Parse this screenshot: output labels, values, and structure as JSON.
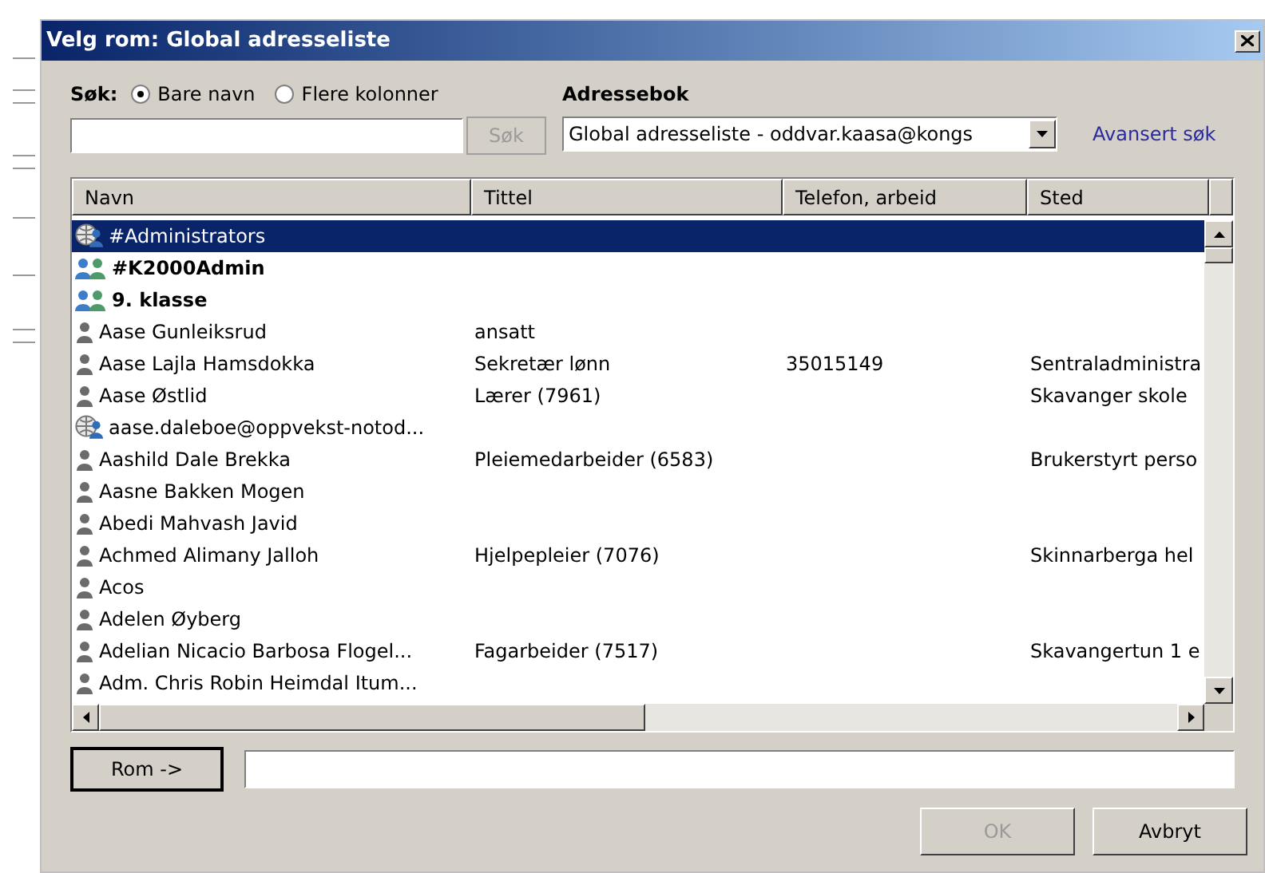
{
  "window": {
    "title": "Velg rom: Global adresseliste"
  },
  "search": {
    "label": "Søk:",
    "options": [
      {
        "label": "Bare navn",
        "selected": true
      },
      {
        "label": "Flere kolonner",
        "selected": false
      }
    ],
    "button": "Søk",
    "button_disabled": true
  },
  "address_book": {
    "label": "Adressebok",
    "value": "Global adresseliste - oddvar.kaasa@kongs",
    "advanced_link": "Avansert søk"
  },
  "table": {
    "columns": [
      "Navn",
      "Tittel",
      "Telefon, arbeid",
      "Sted"
    ],
    "rows": [
      {
        "kind": "external",
        "bold": false,
        "selected": true,
        "cells": [
          "#Administrators",
          "",
          "",
          ""
        ]
      },
      {
        "kind": "group",
        "bold": true,
        "selected": false,
        "cells": [
          "#K2000Admin",
          "",
          "",
          ""
        ]
      },
      {
        "kind": "group",
        "bold": true,
        "selected": false,
        "cells": [
          "9. klasse",
          "",
          "",
          ""
        ]
      },
      {
        "kind": "person",
        "bold": false,
        "selected": false,
        "cells": [
          "Aase Gunleiksrud",
          "ansatt",
          "",
          ""
        ]
      },
      {
        "kind": "person",
        "bold": false,
        "selected": false,
        "cells": [
          "Aase Lajla Hamsdokka",
          "Sekretær lønn",
          "35015149",
          "Sentraladministra"
        ]
      },
      {
        "kind": "person",
        "bold": false,
        "selected": false,
        "cells": [
          "Aase Østlid",
          "Lærer (7961)",
          "",
          "Skavanger skole"
        ]
      },
      {
        "kind": "external",
        "bold": false,
        "selected": false,
        "cells": [
          "aase.daleboe@oppvekst-notod...",
          "",
          "",
          ""
        ]
      },
      {
        "kind": "person",
        "bold": false,
        "selected": false,
        "cells": [
          "Aashild Dale Brekka",
          "Pleiemedarbeider (6583)",
          "",
          "Brukerstyrt perso"
        ]
      },
      {
        "kind": "person",
        "bold": false,
        "selected": false,
        "cells": [
          "Aasne Bakken Mogen",
          "",
          "",
          ""
        ]
      },
      {
        "kind": "person",
        "bold": false,
        "selected": false,
        "cells": [
          "Abedi Mahvash Javid",
          "",
          "",
          ""
        ]
      },
      {
        "kind": "person",
        "bold": false,
        "selected": false,
        "cells": [
          "Achmed Alimany Jalloh",
          "Hjelpepleier (7076)",
          "",
          "Skinnarberga hel"
        ]
      },
      {
        "kind": "person",
        "bold": false,
        "selected": false,
        "cells": [
          "Acos",
          "",
          "",
          ""
        ]
      },
      {
        "kind": "person",
        "bold": false,
        "selected": false,
        "cells": [
          "Adelen Øyberg",
          "",
          "",
          ""
        ]
      },
      {
        "kind": "person",
        "bold": false,
        "selected": false,
        "cells": [
          "Adelian Nicacio Barbosa Flogel...",
          "Fagarbeider (7517)",
          "",
          "Skavangertun 1 e"
        ]
      },
      {
        "kind": "person",
        "bold": false,
        "selected": false,
        "cells": [
          "Adm. Chris Robin Heimdal Itum...",
          "",
          "",
          ""
        ]
      }
    ]
  },
  "room_button": "Rom ->",
  "buttons": [
    {
      "label": "OK",
      "disabled": true
    },
    {
      "label": "Avbryt",
      "disabled": false
    }
  ]
}
